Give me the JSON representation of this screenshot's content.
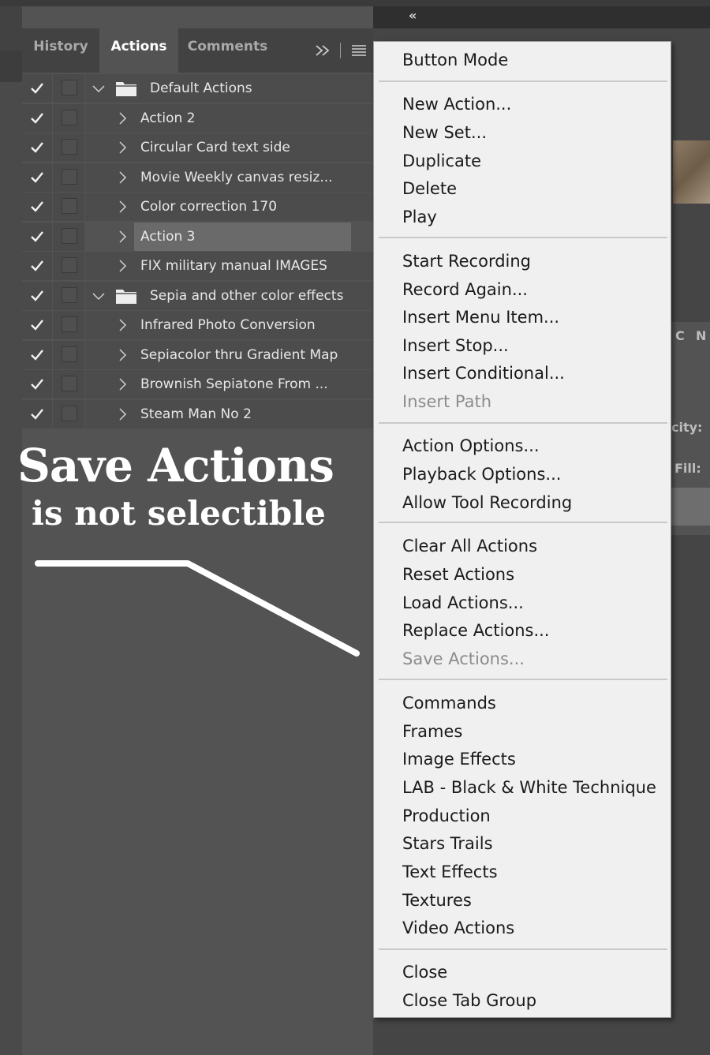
{
  "tabs": [
    {
      "label": "History",
      "active": false
    },
    {
      "label": "Actions",
      "active": true
    },
    {
      "label": "Comments",
      "active": false
    }
  ],
  "panel_controls": {
    "expand_icon": "double-chevron-right-icon",
    "menu_icon": "hamburger-menu-icon"
  },
  "actions": [
    {
      "label": "Default Actions",
      "type": "set",
      "checked": true,
      "expanded": true
    },
    {
      "label": "Action 2",
      "type": "action",
      "checked": true
    },
    {
      "label": "Circular Card text side",
      "type": "action",
      "checked": true
    },
    {
      "label": "Movie Weekly canvas resiz...",
      "type": "action",
      "checked": true
    },
    {
      "label": "Color correction 170",
      "type": "action",
      "checked": true
    },
    {
      "label": "Action 3",
      "type": "action",
      "checked": true,
      "selected": true
    },
    {
      "label": "FIX military manual IMAGES",
      "type": "action",
      "checked": true
    },
    {
      "label": "Sepia and other color effects",
      "type": "set",
      "checked": true,
      "expanded": true
    },
    {
      "label": "Infrared Photo Conversion",
      "type": "action",
      "checked": true
    },
    {
      "label": "Sepiacolor thru Gradient Map",
      "type": "action",
      "checked": true
    },
    {
      "label": "Brownish Sepiatone From ...",
      "type": "action",
      "checked": true
    },
    {
      "label": "Steam Man No 2",
      "type": "action",
      "checked": true
    }
  ],
  "caption": {
    "line1": "Save Actions",
    "line2": "is not selectible"
  },
  "menu": {
    "groups": [
      [
        {
          "label": "Button Mode",
          "enabled": true
        }
      ],
      [
        {
          "label": "New Action...",
          "enabled": true
        },
        {
          "label": "New Set...",
          "enabled": true
        },
        {
          "label": "Duplicate",
          "enabled": true
        },
        {
          "label": "Delete",
          "enabled": true
        },
        {
          "label": "Play",
          "enabled": true
        }
      ],
      [
        {
          "label": "Start Recording",
          "enabled": true
        },
        {
          "label": "Record Again...",
          "enabled": true
        },
        {
          "label": "Insert Menu Item...",
          "enabled": true
        },
        {
          "label": "Insert Stop...",
          "enabled": true
        },
        {
          "label": "Insert Conditional...",
          "enabled": true
        },
        {
          "label": "Insert Path",
          "enabled": false
        }
      ],
      [
        {
          "label": "Action Options...",
          "enabled": true
        },
        {
          "label": "Playback Options...",
          "enabled": true
        },
        {
          "label": "Allow Tool Recording",
          "enabled": true
        }
      ],
      [
        {
          "label": "Clear All Actions",
          "enabled": true
        },
        {
          "label": "Reset Actions",
          "enabled": true
        },
        {
          "label": "Load Actions...",
          "enabled": true
        },
        {
          "label": "Replace Actions...",
          "enabled": true
        },
        {
          "label": "Save Actions...",
          "enabled": false
        }
      ],
      [
        {
          "label": "Commands",
          "enabled": true
        },
        {
          "label": "Frames",
          "enabled": true
        },
        {
          "label": "Image Effects",
          "enabled": true
        },
        {
          "label": "LAB - Black & White Technique",
          "enabled": true
        },
        {
          "label": "Production",
          "enabled": true
        },
        {
          "label": "Stars Trails",
          "enabled": true
        },
        {
          "label": "Text Effects",
          "enabled": true
        },
        {
          "label": "Textures",
          "enabled": true
        },
        {
          "label": "Video Actions",
          "enabled": true
        }
      ],
      [
        {
          "label": "Close",
          "enabled": true
        },
        {
          "label": "Close Tab Group",
          "enabled": true
        }
      ]
    ]
  },
  "right_partial": {
    "collapse": "«",
    "col_c": "C",
    "col_n": "N",
    "opacity": "city:",
    "fill": "Fill:"
  }
}
